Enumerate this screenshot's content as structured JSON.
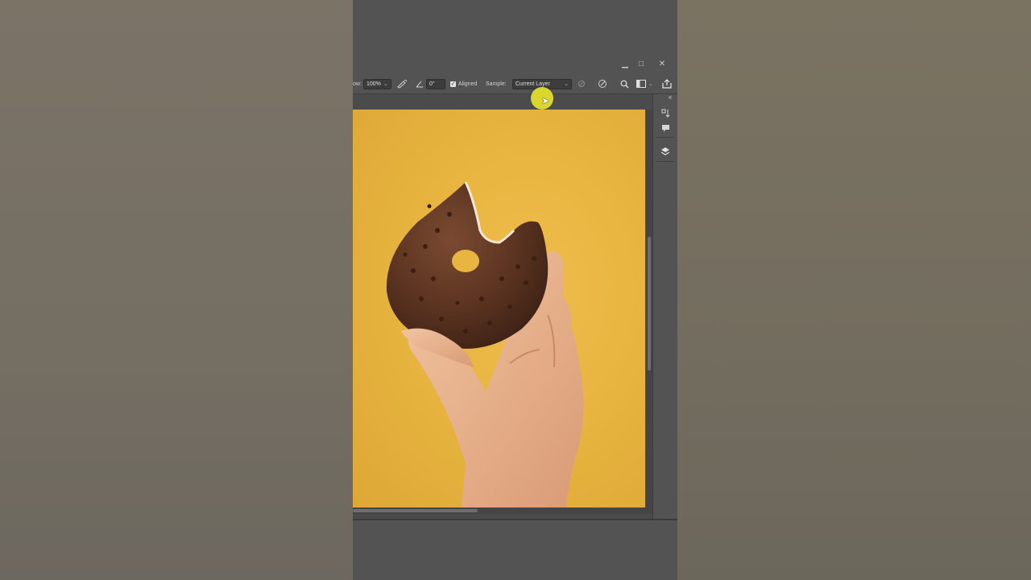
{
  "app": {
    "window_controls": {
      "minimize": "▁",
      "maximize": "□",
      "close": "✕"
    }
  },
  "options_bar": {
    "flow_label": "ow:",
    "flow_value": "100%",
    "angle_value": "0°",
    "aligned_label": "Aligned",
    "aligned_checked": true,
    "sample_label": "Sample:",
    "sample_value": "Current Layer",
    "icons": {
      "airbrush": "airbrush-icon",
      "angle": "angle-icon",
      "ignore_adjustment": "ignore-adjustment-layers-icon",
      "pressure": "pressure-size-icon",
      "search": "search-icon",
      "workspace": "workspace-icon",
      "share": "share-icon"
    }
  },
  "right_panel": {
    "collapse": "«",
    "items": [
      "history-icon",
      "comments-icon",
      "layers-icon"
    ]
  },
  "colors": {
    "ui_bg": "#535353",
    "canvas_bg": "#4b4b4b",
    "photo_bg": "#e8b540",
    "cursor_highlight": "#ebe628"
  }
}
